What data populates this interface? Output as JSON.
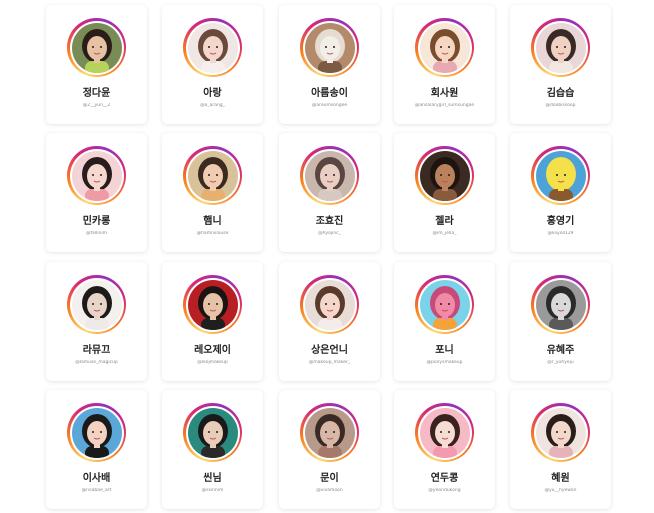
{
  "profiles": [
    {
      "name": "정다윤",
      "handle": "@2__yun__2",
      "palette": {
        "bg": "#7a8c55",
        "skin": "#e7c1a3",
        "hair": "#2a1d18",
        "cloth": "#b7d45a"
      }
    },
    {
      "name": "아랑",
      "handle": "@a_arang_",
      "palette": {
        "bg": "#f0e6e4",
        "skin": "#f3d6cc",
        "hair": "#6b4a3c",
        "cloth": "#f7efec"
      }
    },
    {
      "name": "아름송이",
      "handle": "@areumsongee",
      "palette": {
        "bg": "#b38b6a",
        "skin": "#f2efe9",
        "hair": "#e6dcd2",
        "cloth": "#7c5a44"
      }
    },
    {
      "name": "회사원",
      "handle": "@ansalarygirl_sumsungae",
      "palette": {
        "bg": "#f6e7d9",
        "skin": "#f6d8c2",
        "hair": "#7a4d2c",
        "cloth": "#e9a9b4"
      }
    },
    {
      "name": "김습습",
      "handle": "@doobissoop",
      "palette": {
        "bg": "#e9d6d6",
        "skin": "#f0d2c2",
        "hair": "#3a2a25",
        "cloth": "#f3e7e2"
      }
    },
    {
      "name": "민카롱",
      "handle": "@fallinim",
      "palette": {
        "bg": "#f4d3d6",
        "skin": "#f5d9cf",
        "hair": "#2a1c1c",
        "cloth": "#f09aa6"
      }
    },
    {
      "name": "햄니",
      "handle": "@hamniilouse",
      "palette": {
        "bg": "#d9c19a",
        "skin": "#f0ccb0",
        "hair": "#3b2a20",
        "cloth": "#e8b06e"
      }
    },
    {
      "name": "조효진",
      "handle": "@hyojinc_",
      "palette": {
        "bg": "#c9b7ae",
        "skin": "#e9cfc3",
        "hair": "#5a4540",
        "cloth": "#d8c8c2"
      }
    },
    {
      "name": "젤라",
      "handle": "@im_jella_",
      "palette": {
        "bg": "#3a2a22",
        "skin": "#b9825c",
        "hair": "#1d1410",
        "cloth": "#8a5a3c"
      }
    },
    {
      "name": "홍영기",
      "handle": "@kiiyoll129",
      "palette": {
        "bg": "#4da3d8",
        "skin": "#f4e04a",
        "hair": "#f4e04a",
        "cloth": "#8a5a2c"
      }
    },
    {
      "name": "라뮤끄",
      "handle": "@lamuse_magicup",
      "palette": {
        "bg": "#f3f0ee",
        "skin": "#e8d4c8",
        "hair": "#1d1a1a",
        "cloth": "#eeeae7"
      }
    },
    {
      "name": "레오제이",
      "handle": "@leojmakeup",
      "palette": {
        "bg": "#b81f24",
        "skin": "#e6c2a6",
        "hair": "#1a1414",
        "cloth": "#1f1f1f"
      }
    },
    {
      "name": "상은언니",
      "handle": "@makeup_maker_",
      "palette": {
        "bg": "#e7dcd6",
        "skin": "#f3d7ca",
        "hair": "#5a3a2a",
        "cloth": "#f4ecea"
      }
    },
    {
      "name": "포니",
      "handle": "@ponysmakeup",
      "palette": {
        "bg": "#7ad3e8",
        "skin": "#f08aa6",
        "hair": "#c84a7a",
        "cloth": "#f4a33b"
      }
    },
    {
      "name": "유혜주",
      "handle": "@r_yuhyeju",
      "palette": {
        "bg": "#9a9a9a",
        "skin": "#d9d9d9",
        "hair": "#2a2a2a",
        "cloth": "#5a5a5a"
      }
    },
    {
      "name": "이사배",
      "handle": "@risabae_art",
      "palette": {
        "bg": "#5aa7d8",
        "skin": "#f3d2c4",
        "hair": "#1a1a1a",
        "cloth": "#1a1a1a"
      }
    },
    {
      "name": "씬님",
      "handle": "@ssinnim",
      "palette": {
        "bg": "#2a8a7e",
        "skin": "#e9cdb8",
        "hair": "#1a1a1a",
        "cloth": "#2a2a2a"
      }
    },
    {
      "name": "문이",
      "handle": "@vivamoon",
      "palette": {
        "bg": "#b89a8a",
        "skin": "#d7b8a8",
        "hair": "#3a2a25",
        "cloth": "#a67a6a"
      }
    },
    {
      "name": "연두콩",
      "handle": "@yeondukong",
      "palette": {
        "bg": "#f6b9c6",
        "skin": "#f6dcd2",
        "hair": "#3a2220",
        "cloth": "#f39ab0"
      }
    },
    {
      "name": "혜원",
      "handle": "@yu__hyewon",
      "palette": {
        "bg": "#efe4e0",
        "skin": "#f3d8cc",
        "hair": "#2a1d1a",
        "cloth": "#e8b3b8"
      }
    }
  ]
}
